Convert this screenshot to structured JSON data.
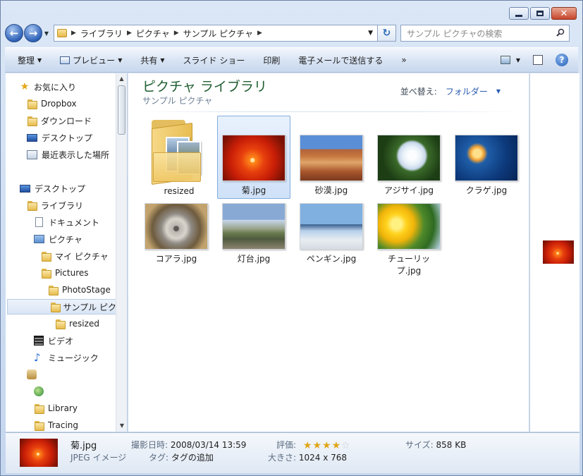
{
  "address": {
    "segments": [
      "ライブラリ",
      "ピクチャ",
      "サンプル ピクチャ"
    ],
    "search_placeholder": "サンプル ピクチャの検索"
  },
  "toolbar": {
    "organize": "整理",
    "preview": "プレビュー",
    "share": "共有",
    "slideshow": "スライド ショー",
    "print": "印刷",
    "email": "電子メールで送信する",
    "more": "»",
    "help": "?"
  },
  "nav": {
    "favorites": "お気に入り",
    "dropbox": "Dropbox",
    "downloads": "ダウンロード",
    "desktop_fav": "デスクトップ",
    "recent": "最近表示した場所",
    "desktop": "デスクトップ",
    "libraries": "ライブラリ",
    "documents": "ドキュメント",
    "pictures": "ピクチャ",
    "my_pictures": "マイ ピクチャ",
    "pictures_en": "Pictures",
    "photostage": "PhotoStage",
    "sample_pictures": "サンプル ピク",
    "resized": "resized",
    "videos": "ビデオ",
    "music": "ミュージック",
    "library": "Library",
    "tracing": "Tracing"
  },
  "content": {
    "title": "ピクチャ ライブラリ",
    "subtitle": "サンプル ピクチャ",
    "sort_label": "並べ替え:",
    "sort_value": "フォルダー",
    "items": [
      {
        "label": "resized"
      },
      {
        "label": "菊.jpg"
      },
      {
        "label": "砂漠.jpg"
      },
      {
        "label": "アジサイ.jpg"
      },
      {
        "label": "クラゲ.jpg"
      },
      {
        "label": "コアラ.jpg"
      },
      {
        "label": "灯台.jpg"
      },
      {
        "label": "ペンギン.jpg"
      },
      {
        "label": "チューリップ.jpg"
      }
    ]
  },
  "details": {
    "filename": "菊.jpg",
    "filetype": "JPEG イメージ",
    "date_key": "撮影日時:",
    "date_value": "2008/03/14 13:59",
    "tags_key": "タグ:",
    "tags_value": "タグの追加",
    "rating_key": "評価:",
    "rating": 4,
    "rating_max": 5,
    "dimensions_key": "大きさ:",
    "dimensions_value": "1024 x 768",
    "size_key": "サイズ:",
    "size_value": "858 KB"
  }
}
